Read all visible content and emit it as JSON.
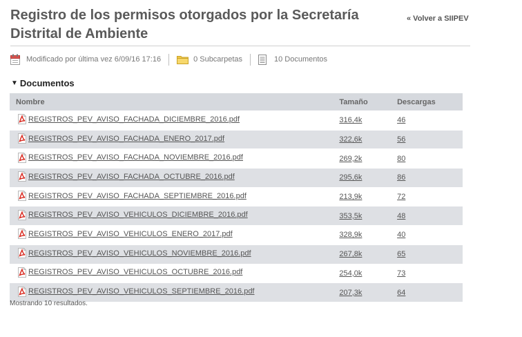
{
  "header": {
    "title": "Registro de los permisos otorgados por la Secretaría Distrital de Ambiente",
    "back_link": "« Volver a SIIPEV"
  },
  "meta": {
    "modified": "Modificado por última vez 6/09/16 17:16",
    "subfolders": "0 Subcarpetas",
    "documents": "10 Documentos",
    "icons": [
      "calendar-icon",
      "folder-icon",
      "document-icon"
    ]
  },
  "section": {
    "label": "Documentos"
  },
  "table": {
    "columns": [
      "Nombre",
      "Tamaño",
      "Descargas"
    ],
    "rows": [
      {
        "name": "REGISTROS_PEV_AVISO_FACHADA_DICIEMBRE_2016.pdf",
        "size": "316,4k",
        "downloads": "46"
      },
      {
        "name": "REGISTROS_PEV_AVISO_FACHADA_ENERO_2017.pdf",
        "size": "322,6k",
        "downloads": "56"
      },
      {
        "name": "REGISTROS_PEV_AVISO_FACHADA_NOVIEMBRE_2016.pdf",
        "size": "269,2k",
        "downloads": "80"
      },
      {
        "name": "REGISTROS_PEV_AVISO_FACHADA_OCTUBRE_2016.pdf",
        "size": "295,6k",
        "downloads": "86"
      },
      {
        "name": "REGISTROS_PEV_AVISO_FACHADA_SEPTIEMBRE_2016.pdf",
        "size": "213,9k",
        "downloads": "72"
      },
      {
        "name": "REGISTROS_PEV_AVISO_VEHICULOS_DICIEMBRE_2016.pdf",
        "size": "353,5k",
        "downloads": "48"
      },
      {
        "name": "REGISTROS_PEV_AVISO_VEHICULOS_ENERO_2017.pdf",
        "size": "328,9k",
        "downloads": "40"
      },
      {
        "name": "REGISTROS_PEV_AVISO_VEHICULOS_NOVIEMBRE_2016.pdf",
        "size": "267,8k",
        "downloads": "65"
      },
      {
        "name": "REGISTROS_PEV_AVISO_VEHICULOS_OCTUBRE_2016.pdf",
        "size": "254,0k",
        "downloads": "73"
      },
      {
        "name": "REGISTROS_PEV_AVISO_VEHICULOS_SEPTIEMBRE_2016.pdf",
        "size": "207,3k",
        "downloads": "64"
      }
    ]
  },
  "footer": {
    "results": "Mostrando 10 resultados."
  }
}
